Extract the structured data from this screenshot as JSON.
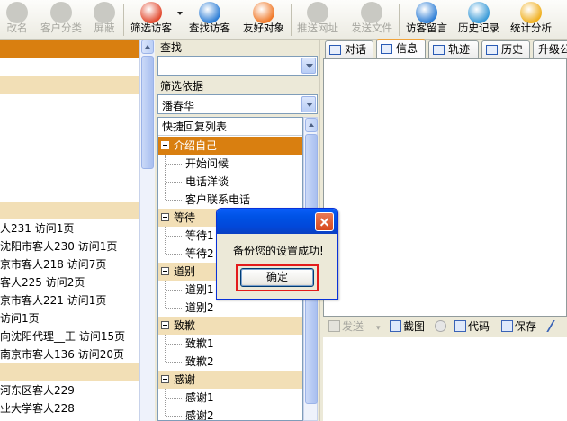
{
  "toolbar": {
    "buttons": [
      {
        "label": "改名",
        "icon": "rename-icon",
        "enabled": false
      },
      {
        "label": "客户分类",
        "icon": "customer-category-icon",
        "enabled": false
      },
      {
        "label": "屏蔽",
        "icon": "block-icon",
        "enabled": false
      },
      {
        "label": "筛选访客",
        "icon": "filter-visitor-icon",
        "enabled": true
      },
      {
        "label": "查找访客",
        "icon": "find-visitor-icon",
        "enabled": true
      },
      {
        "label": "友好对象",
        "icon": "friend-target-icon",
        "enabled": true
      },
      {
        "label": "推送网址",
        "icon": "push-url-icon",
        "enabled": false
      },
      {
        "label": "发送文件",
        "icon": "send-file-icon",
        "enabled": false
      },
      {
        "label": "访客留言",
        "icon": "visitor-message-icon",
        "enabled": true
      },
      {
        "label": "历史记录",
        "icon": "history-icon",
        "enabled": true
      },
      {
        "label": "统计分析",
        "icon": "statistics-icon",
        "enabled": true
      }
    ],
    "colors": {
      "accent": "#d97f10",
      "group_bg": "#f2dfb6"
    }
  },
  "visitor_list": {
    "rows": [
      {
        "text": "",
        "style": "selected"
      },
      {
        "text": "",
        "style": "plain"
      },
      {
        "text": "",
        "style": "group"
      },
      {
        "text": "",
        "style": "plain"
      },
      {
        "text": "",
        "style": "plain"
      },
      {
        "text": "",
        "style": "plain"
      },
      {
        "text": "",
        "style": "plain"
      },
      {
        "text": "",
        "style": "plain"
      },
      {
        "text": "",
        "style": "plain"
      },
      {
        "text": "",
        "style": "group"
      },
      {
        "text": "人231 访问1页",
        "style": "plain"
      },
      {
        "text": "沈阳市客人230 访问1页",
        "style": "plain"
      },
      {
        "text": "京市客人218 访问7页",
        "style": "plain"
      },
      {
        "text": "客人225 访问2页",
        "style": "plain"
      },
      {
        "text": "京市客人221 访问1页",
        "style": "plain"
      },
      {
        "text": "访问1页",
        "style": "plain"
      },
      {
        "text": "向沈阳代理__王 访问15页",
        "style": "plain"
      },
      {
        "text": "南京市客人136 访问20页",
        "style": "plain"
      },
      {
        "text": "",
        "style": "group"
      },
      {
        "text": "河东区客人229",
        "style": "plain"
      },
      {
        "text": "业大学客人228",
        "style": "plain"
      }
    ]
  },
  "filter_panel": {
    "search_label": "查找",
    "search_value": "",
    "filter_label": "筛选依据",
    "filter_value": "潘春华",
    "quick_reply": {
      "header": "快捷回复列表",
      "groups": [
        {
          "name": "介绍自己",
          "selected": true,
          "items": [
            "开始问候",
            "电话洋谈",
            "客户联系电话"
          ]
        },
        {
          "name": "等待",
          "selected": false,
          "items": [
            "等待1",
            "等待2"
          ]
        },
        {
          "name": "道别",
          "selected": false,
          "items": [
            "道别1",
            "道别2"
          ]
        },
        {
          "name": "致歉",
          "selected": false,
          "items": [
            "致歉1",
            "致歉2"
          ]
        },
        {
          "name": "感谢",
          "selected": false,
          "items": [
            "感谢1",
            "感谢2"
          ]
        }
      ]
    }
  },
  "chat_panel": {
    "tabs": [
      {
        "label": "对话",
        "icon": "chat-icon",
        "active": false
      },
      {
        "label": "信息",
        "icon": "info-icon",
        "active": true
      },
      {
        "label": "轨迹",
        "icon": "track-icon",
        "active": false
      },
      {
        "label": "历史",
        "icon": "history-tab-icon",
        "active": false
      },
      {
        "label": "升级公",
        "icon": "",
        "active": false
      }
    ],
    "send_toolbar": {
      "send": "发送",
      "screenshot": "截图",
      "code": "代码",
      "save": "保存"
    }
  },
  "dialog": {
    "message": "备份您的设置成功!",
    "ok": "确定"
  }
}
